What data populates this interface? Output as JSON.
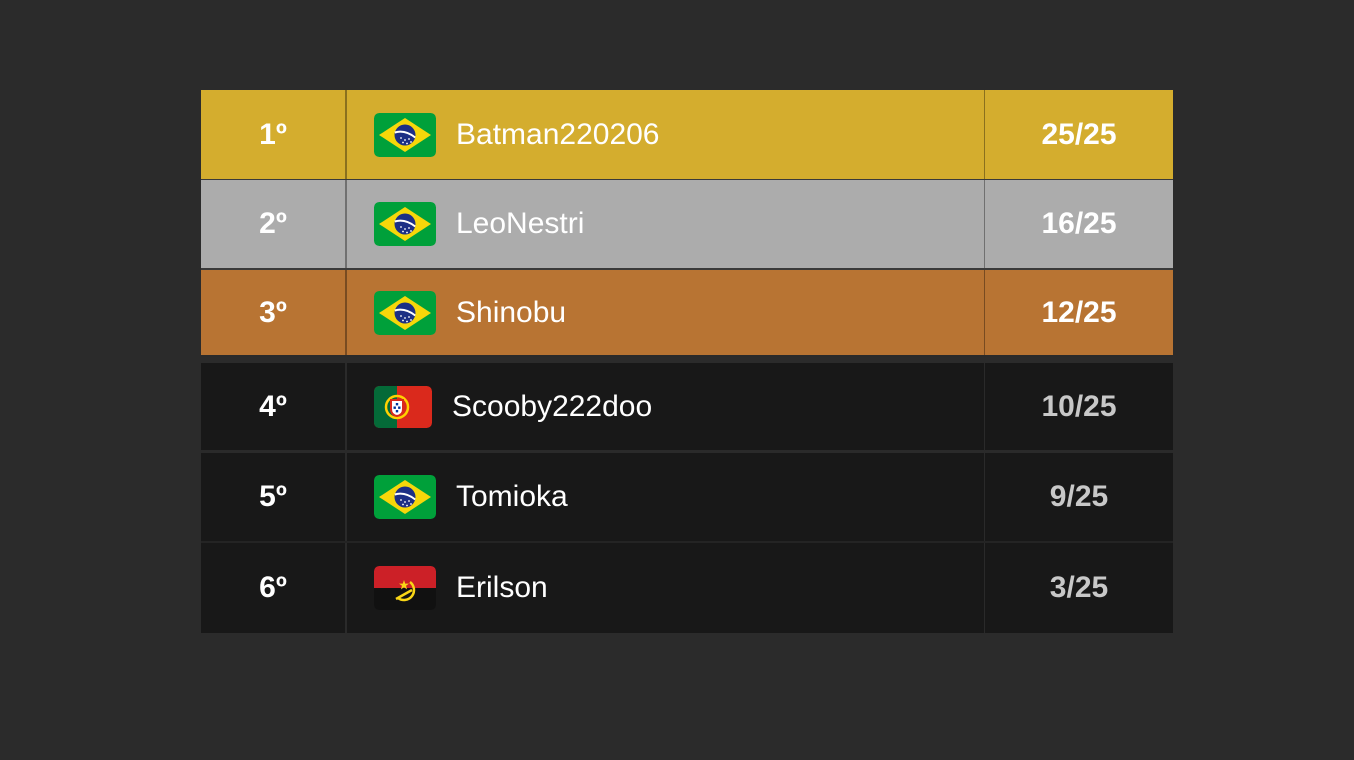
{
  "colors": {
    "background": "#2b2b2b",
    "gold": "#d4ad2e",
    "silver": "#acacac",
    "bronze": "#b87433",
    "dark_row": "#181818",
    "divider": "#333333"
  },
  "ranking": [
    {
      "position": "1º",
      "name": "Batman220206",
      "score": "25/25",
      "flag": "brazil-flag-icon",
      "tier": "gold"
    },
    {
      "position": "2º",
      "name": "LeoNestri",
      "score": "16/25",
      "flag": "brazil-flag-icon",
      "tier": "silver"
    },
    {
      "position": "3º",
      "name": "Shinobu",
      "score": "12/25",
      "flag": "brazil-flag-icon",
      "tier": "bronze"
    },
    {
      "position": "4º",
      "name": "Scooby222doo",
      "score": "10/25",
      "flag": "portugal-flag-icon",
      "tier": "normal"
    },
    {
      "position": "5º",
      "name": "Tomioka",
      "score": "9/25",
      "flag": "brazil-flag-icon",
      "tier": "normal"
    },
    {
      "position": "6º",
      "name": "Erilson",
      "score": "3/25",
      "flag": "angola-flag-icon",
      "tier": "normal"
    }
  ]
}
